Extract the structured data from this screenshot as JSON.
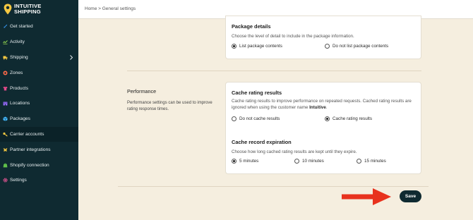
{
  "brand": {
    "name_line1": "INTUITIVE",
    "name_line2": "SHIPPING",
    "accent_color": "#f5c842"
  },
  "sidebar": {
    "items": [
      {
        "label": "Get started",
        "icon": "rocket-icon",
        "icon_color": "#3aa0ff"
      },
      {
        "label": "Activity",
        "icon": "activity-icon",
        "icon_color": "#8fd14f"
      },
      {
        "label": "Shipping",
        "icon": "shipping-icon",
        "icon_color": "#f5c842"
      },
      {
        "label": "Zones",
        "icon": "zone-icon",
        "icon_color": "#ff6b4a"
      },
      {
        "label": "Products",
        "icon": "shirt-icon",
        "icon_color": "#e24a8a"
      },
      {
        "label": "Locations",
        "icon": "building-icon",
        "icon_color": "#9a6bff"
      },
      {
        "label": "Packages",
        "icon": "package-icon",
        "icon_color": "#43b8ff"
      },
      {
        "label": "Carrier accounts",
        "icon": "key-icon",
        "icon_color": "#f5c842"
      },
      {
        "label": "Partner integrations",
        "icon": "partner-icon",
        "icon_color": "#f5c842"
      },
      {
        "label": "Shopify connection",
        "icon": "shopify-icon",
        "icon_color": "#5fbf4a"
      },
      {
        "label": "Settings",
        "icon": "gear-icon",
        "icon_color": "#ff5aa0"
      }
    ]
  },
  "header": {
    "breadcrumb": "Home > General settings"
  },
  "package_details": {
    "title": "Package details",
    "description": "Choose the level of detail to include in the package information.",
    "options": [
      "List package contents",
      "Do not list package contents"
    ],
    "selected": "List package contents"
  },
  "performance": {
    "section_title": "Performance",
    "section_description": "Performance settings can be used to improve rating response times.",
    "cache_rating": {
      "title": "Cache rating results",
      "description_prefix": "Cache rating results to improve performance on repeated requests. Cached rating results are ignored when using the customer name ",
      "description_bold": "Intuitive",
      "description_suffix": ".",
      "options": [
        "Do not cache results",
        "Cache rating results"
      ],
      "selected": "Cache rating results"
    },
    "cache_expiration": {
      "title": "Cache record expiration",
      "description": "Choose how long cached rating results are kept until they expire.",
      "options": [
        "5 minutes",
        "10 minutes",
        "15 minutes"
      ],
      "selected": "5 minutes"
    }
  },
  "actions": {
    "save_label": "Save"
  },
  "colors": {
    "sidebar_bg": "#0f2a31",
    "page_bg": "#f5eedf",
    "annotation_arrow": "#e8321e"
  }
}
